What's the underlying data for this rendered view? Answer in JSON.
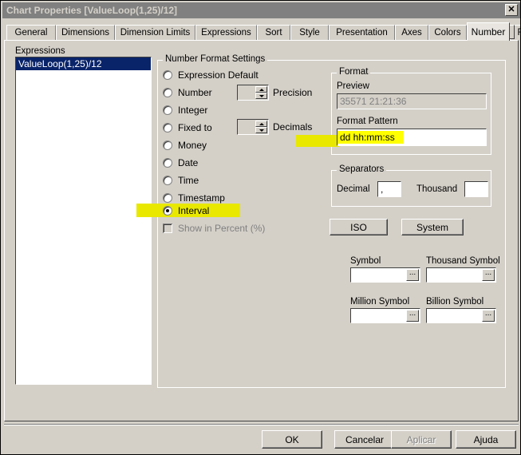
{
  "window": {
    "title": "Chart Properties [ValueLoop(1,25)/12]",
    "close_label": "✕"
  },
  "tabs": [
    {
      "label": "General",
      "active": false
    },
    {
      "label": "Dimensions",
      "active": false
    },
    {
      "label": "Dimension Limits",
      "active": false
    },
    {
      "label": "Expressions",
      "active": false
    },
    {
      "label": "Sort",
      "active": false
    },
    {
      "label": "Style",
      "active": false
    },
    {
      "label": "Presentation",
      "active": false
    },
    {
      "label": "Axes",
      "active": false
    },
    {
      "label": "Colors",
      "active": false
    },
    {
      "label": "Number",
      "active": true
    },
    {
      "label": "Font",
      "active": false
    }
  ],
  "expressions": {
    "label": "Expressions",
    "items": [
      {
        "text": "ValueLoop(1,25)/12",
        "selected": true
      }
    ]
  },
  "number_format_settings": {
    "title": "Number Format Settings",
    "options": [
      {
        "label": "Expression Default",
        "checked": false
      },
      {
        "label": "Number",
        "checked": false
      },
      {
        "label": "Integer",
        "checked": false
      },
      {
        "label": "Fixed to",
        "checked": false
      },
      {
        "label": "Money",
        "checked": false
      },
      {
        "label": "Date",
        "checked": false
      },
      {
        "label": "Time",
        "checked": false
      },
      {
        "label": "Timestamp",
        "checked": false
      },
      {
        "label": "Interval",
        "checked": true
      }
    ],
    "precision_label": "Precision",
    "precision_value": "",
    "decimals_label": "Decimals",
    "decimals_value": "",
    "show_percent_label": "Show in Percent (%)",
    "show_percent_checked": false,
    "show_percent_disabled": true
  },
  "format": {
    "title": "Format",
    "preview_label": "Preview",
    "preview_value": "35571 21:21:36",
    "pattern_label": "Format Pattern",
    "pattern_value": "dd hh:mm:ss"
  },
  "separators": {
    "title": "Separators",
    "decimal_label": "Decimal",
    "decimal_value": ",",
    "thousand_label": "Thousand",
    "thousand_value": ""
  },
  "preset_buttons": {
    "iso_label": "ISO",
    "system_label": "System"
  },
  "symbols": [
    {
      "label": "Symbol",
      "value": "",
      "button": "..."
    },
    {
      "label": "Thousand Symbol",
      "value": "",
      "button": "..."
    },
    {
      "label": "Million Symbol",
      "value": "",
      "button": "..."
    },
    {
      "label": "Billion Symbol",
      "value": "",
      "button": "..."
    }
  ],
  "dialog_buttons": [
    {
      "label": "OK",
      "disabled": false
    },
    {
      "label": "Cancelar",
      "disabled": false
    },
    {
      "label": "Aplicar",
      "disabled": true
    },
    {
      "label": "Ajuda",
      "disabled": false
    }
  ],
  "tab_scroll": {
    "left": "◀",
    "right": "▶"
  },
  "colors": {
    "highlight": "#e8e800",
    "highlight_bright": "#ffff00",
    "selection": "#0a246a",
    "face": "#d4d0c8",
    "titlebar": "#808080"
  }
}
